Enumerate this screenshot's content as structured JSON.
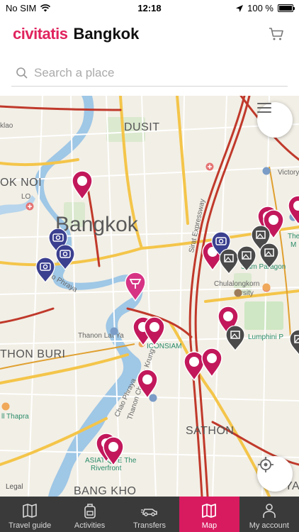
{
  "status_bar": {
    "carrier": "No SIM",
    "time": "12:18",
    "battery": "100 %",
    "battery_level": 1.0
  },
  "header": {
    "logo": "civitatis",
    "city": "Bangkok"
  },
  "search": {
    "placeholder": "Search a place",
    "value": ""
  },
  "map": {
    "labels": {
      "dusit": "DUSIT",
      "ok_noi": "OK NOI",
      "bangkok": "Bangkok",
      "thon_buri": "THON BURI",
      "sathon": "SATHON",
      "bang_kho": "BANG KHO",
      "ya": "YA",
      "chulalongkorn": "Chulalongkorn",
      "university": "ersity",
      "lumphini": "Lumphini P",
      "iconsiam": "ICONSIAM",
      "asiatique": "ASIATIQUE The",
      "riverfront": "Riverfront",
      "victory": "Victory",
      "siam_paragon": "Siam Paragon",
      "thonburi_thapra": "ll Thapra",
      "kao": "klao",
      "lo": "LO",
      "the_m": "The",
      "the_m2": "M",
      "thanon_lat_ya": "Thanon Lat Ya",
      "thanon_charoen_krung": "Thanon Charoen Krung",
      "chao_phraya": "Chao Phraya",
      "chao_phraya2": "o Phraya",
      "sirat_expressway": "Sirat Expressway",
      "legal": "Legal"
    },
    "colors": {
      "land": "#f2efe6",
      "river": "#9fc7e6",
      "park": "#cfe7c4",
      "road_major": "#f4c54a",
      "road_highway": "#c0392b",
      "pin_activity": "#c2185b",
      "pin_monument": "#3b3f8f",
      "pin_dark": "#4a4a4a",
      "pin_pink": "#d63384"
    }
  },
  "controls": {
    "menu_icon": "hamburger-icon",
    "locate_icon": "crosshair-icon"
  },
  "tabbar": {
    "tabs": [
      {
        "label": "Travel guide",
        "icon": "map-book-icon"
      },
      {
        "label": "Activities",
        "icon": "backpack-icon"
      },
      {
        "label": "Transfers",
        "icon": "car-icon"
      },
      {
        "label": "Map",
        "icon": "map-icon"
      },
      {
        "label": "My account",
        "icon": "user-icon"
      }
    ],
    "active": "Map"
  }
}
